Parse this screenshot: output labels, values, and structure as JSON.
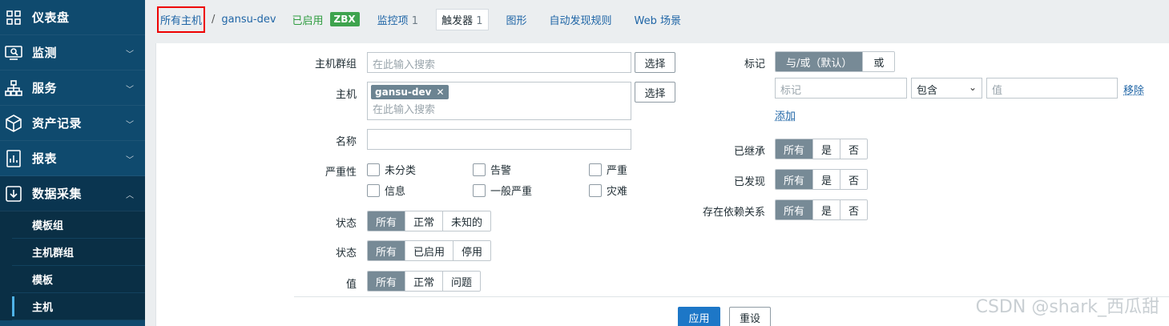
{
  "sidebar": {
    "items": [
      {
        "label": "仪表盘",
        "icon": "dashboard-icon"
      },
      {
        "label": "监测",
        "icon": "monitoring-icon"
      },
      {
        "label": "服务",
        "icon": "services-icon"
      },
      {
        "label": "资产记录",
        "icon": "inventory-icon"
      },
      {
        "label": "报表",
        "icon": "reports-icon"
      },
      {
        "label": "数据采集",
        "icon": "data-collection-icon"
      }
    ],
    "subitems": [
      "模板组",
      "主机群组",
      "模板",
      "主机"
    ]
  },
  "breadcrumb": {
    "all_hosts": "所有主机",
    "sep": "/",
    "host": "gansu-dev",
    "enabled": "已启用",
    "zbx": "ZBX"
  },
  "tabs": [
    {
      "label": "监控项",
      "count": "1"
    },
    {
      "label": "触发器",
      "count": "1"
    },
    {
      "label": "图形",
      "count": ""
    },
    {
      "label": "自动发现规则",
      "count": ""
    },
    {
      "label": "Web 场景",
      "count": ""
    }
  ],
  "filter": {
    "host_group_label": "主机群组",
    "host_group_placeholder": "在此输入搜索",
    "select_label": "选择",
    "host_label": "主机",
    "host_chip": "gansu-dev",
    "host_placeholder": "在此输入搜索",
    "name_label": "名称",
    "severity_label": "严重性",
    "severities": [
      "未分类",
      "告警",
      "严重",
      "信息",
      "一般严重",
      "灾难"
    ],
    "state_label": "状态",
    "state_options": [
      "所有",
      "正常",
      "未知的"
    ],
    "status_label": "状态",
    "status_options": [
      "所有",
      "已启用",
      "停用"
    ],
    "value_label": "值",
    "value_options": [
      "所有",
      "正常",
      "问题"
    ],
    "tags_label": "标记",
    "tags_options": [
      "与/或（默认）",
      "或"
    ],
    "tag_placeholder": "标记",
    "tag_operator": "包含",
    "tag_value_placeholder": "值",
    "remove_label": "移除",
    "add_label": "添加",
    "inherited_label": "已继承",
    "discovered_label": "已发现",
    "dependencies_label": "存在依赖关系",
    "yes_no_options": [
      "所有",
      "是",
      "否"
    ],
    "apply_label": "应用",
    "reset_label": "重设"
  },
  "watermark": "CSDN @shark_西瓜甜"
}
